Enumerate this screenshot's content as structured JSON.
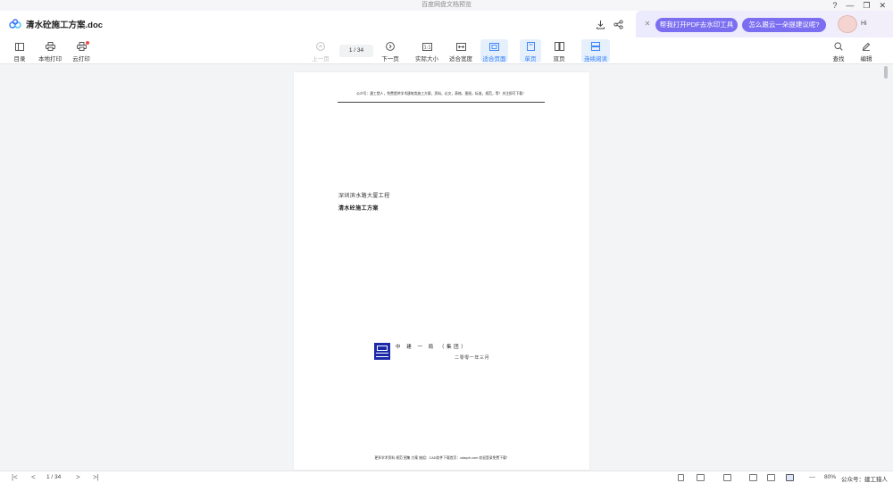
{
  "window": {
    "title": "百度网盘文档预览",
    "controls": {
      "help": "?",
      "minimize": "—",
      "restore": "❐",
      "close": "✕"
    }
  },
  "header": {
    "doc_title": "清水砼施工方案.doc",
    "download_icon": "download-icon",
    "share_icon": "share-icon"
  },
  "promo": {
    "close": "✕",
    "button1": "帮我打开PDF去水印工具",
    "button2": "怎么跟云一朵提建议呢?",
    "greeting": "Hi"
  },
  "toolbar": {
    "toc": "目录",
    "local_print": "本地打印",
    "cloud_print": "云打印",
    "prev_page": "上一页",
    "page_indicator": "1 / 34",
    "next_page": "下一页",
    "actual_size": "实际大小",
    "fit_width": "适合宽度",
    "fit_page": "适合页面",
    "single_page": "单页",
    "double_page": "双页",
    "continuous": "连续阅读",
    "find": "查找",
    "edit": "编辑"
  },
  "document": {
    "header_text": "公众号：建工猎人，免费提供学术建筑类施工方案，资料，论文，表格，图纸，标准，规范，等！关注即可下载！",
    "subtitle": "深圳滨水路大厦工程",
    "title": "清水砼施工方案",
    "organization": "中 建 一 局 （集团）",
    "date": "二零零一年三月",
    "footer_text": "更多学术资料 规范 图集 方案 施组：CAD软件下载首页：cdaych.com 欢迎登录免费下载！"
  },
  "statusbar": {
    "first": "|<",
    "prev": "<",
    "page": "1 / 34",
    "next": ">",
    "last": ">|",
    "zoom_out": "—",
    "zoom": "80%"
  },
  "watermark": "公众号：建工猎人"
}
